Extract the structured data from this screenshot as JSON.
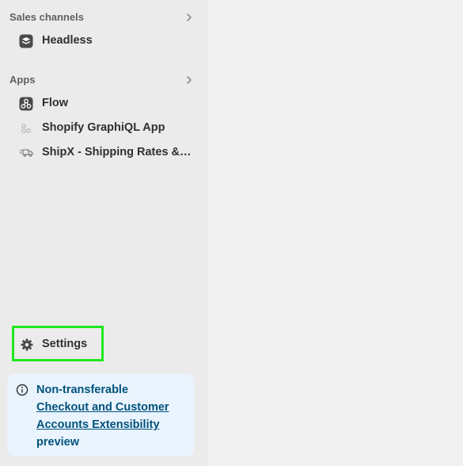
{
  "sidebar": {
    "sales_channels": {
      "title": "Sales channels",
      "items": [
        {
          "label": "Headless",
          "icon": "headless-icon"
        }
      ]
    },
    "apps": {
      "title": "Apps",
      "items": [
        {
          "label": "Flow",
          "icon": "flow-icon"
        },
        {
          "label": "Shopify GraphiQL App",
          "icon": "graphiql-app-icon"
        },
        {
          "label": "ShipX - Shipping Rates & Delivery",
          "icon": "truck-icon"
        }
      ]
    },
    "settings": {
      "label": "Settings",
      "icon": "gear-icon"
    },
    "banner": {
      "title": "Non-transferable",
      "link_text": "Checkout and Customer Accounts Extensibility",
      "suffix": "preview",
      "icon": "info-icon"
    }
  },
  "colors": {
    "sidebar_bg": "#ebebeb",
    "main_bg": "#f1f1f1",
    "banner_bg": "#eaf4ff",
    "banner_text": "#00527c",
    "highlight": "#1fe81f"
  }
}
